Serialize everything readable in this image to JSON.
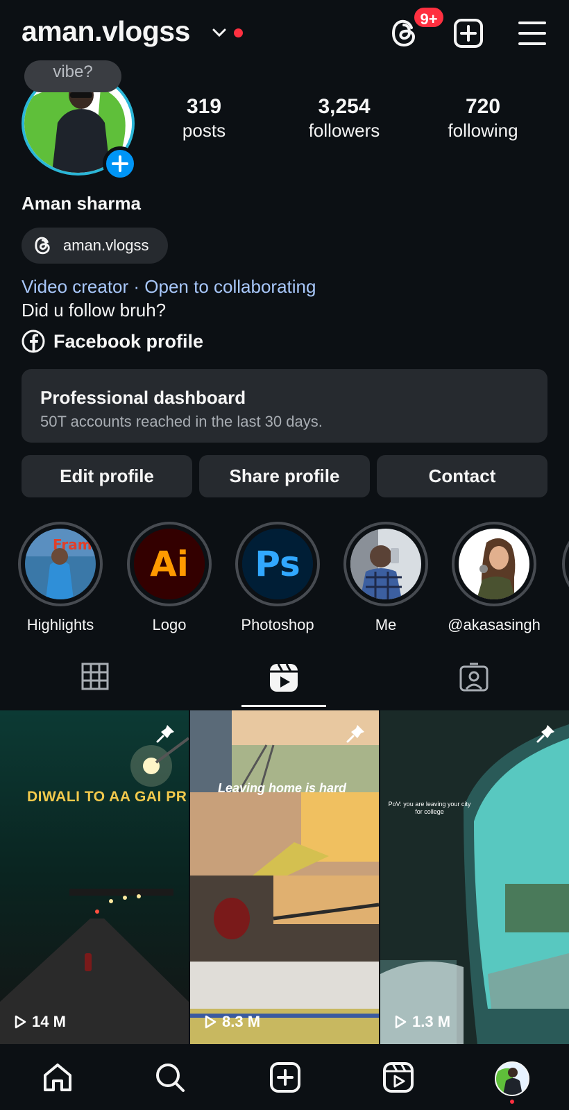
{
  "header": {
    "username": "aman.vlogss",
    "badge_count": "9+",
    "icons": [
      "threads-icon",
      "create-icon",
      "menu-icon"
    ]
  },
  "profile": {
    "note": "vibe?",
    "stats": [
      {
        "value": "319",
        "label": "posts"
      },
      {
        "value": "3,254",
        "label": "followers"
      },
      {
        "value": "720",
        "label": "following"
      }
    ],
    "full_name": "Aman sharma",
    "threads_handle": "aman.vlogss",
    "category": "Video creator · Open to collaborating",
    "bio": "Did u follow bruh?",
    "facebook_link": "Facebook profile"
  },
  "dashboard": {
    "title": "Professional dashboard",
    "subtitle": "50T accounts reached in the last 30 days."
  },
  "buttons": {
    "edit": "Edit profile",
    "share": "Share profile",
    "contact": "Contact"
  },
  "highlights": [
    {
      "label": "Highlights"
    },
    {
      "label": "Logo",
      "glyph": "Ai"
    },
    {
      "label": "Photoshop",
      "glyph": "Ps"
    },
    {
      "label": "Me"
    },
    {
      "label": "@akasasingh"
    }
  ],
  "tabs": [
    "grid-icon",
    "reels-icon",
    "tagged-icon"
  ],
  "reels": [
    {
      "caption": "DIWALI TO AA GAI PR",
      "views": "14 M"
    },
    {
      "caption": "Leaving home is hard",
      "views": "8.3 M"
    },
    {
      "caption": "PoV: you are leaving your city for college",
      "views": "1.3 M"
    }
  ],
  "colors": {
    "background": "#0c1014",
    "surface": "#262a2f",
    "accent_blue": "#0095f6",
    "link_blue": "#a8c7fa",
    "notification_red": "#ff3040"
  }
}
